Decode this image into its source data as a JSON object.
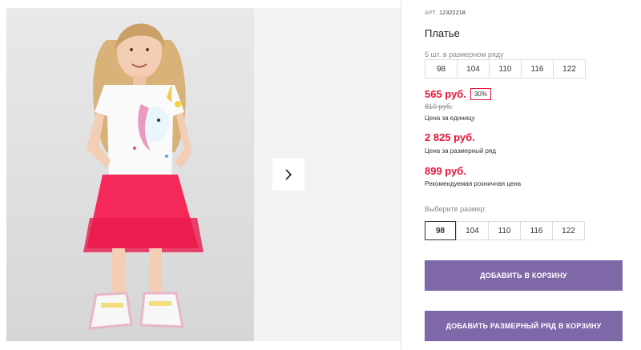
{
  "product": {
    "article_label": "АРТ.",
    "article_number": "12322218",
    "title": "Платье",
    "pack_text": "5 шт. в размерном ряду",
    "pack_sizes": [
      "98",
      "104",
      "110",
      "116",
      "122"
    ]
  },
  "pricing": {
    "unit_price": "565 руб.",
    "discount": "30%",
    "old_price": "810 руб.",
    "unit_label": "Цена за единицу",
    "pack_price": "2 825 руб.",
    "pack_label": "Цена за размерный ряд",
    "retail_price": "899 руб.",
    "retail_label": "Рекомендуемая розничная цена"
  },
  "size_selector": {
    "label": "Выберите размер:",
    "sizes": [
      "98",
      "104",
      "110",
      "116",
      "122"
    ],
    "selected": "98"
  },
  "actions": {
    "add_to_cart": "ДОБАВИТЬ В КОРЗИНУ",
    "add_pack_to_cart": "ДОБАВИТЬ РАЗМЕРНЫЙ РЯД В КОРЗИНУ"
  },
  "colors": {
    "price_red": "#e8163c",
    "button_purple": "#7e68a8",
    "tutu_pink": "#f5285a"
  },
  "icons": {
    "next": "chevron-right-icon"
  }
}
